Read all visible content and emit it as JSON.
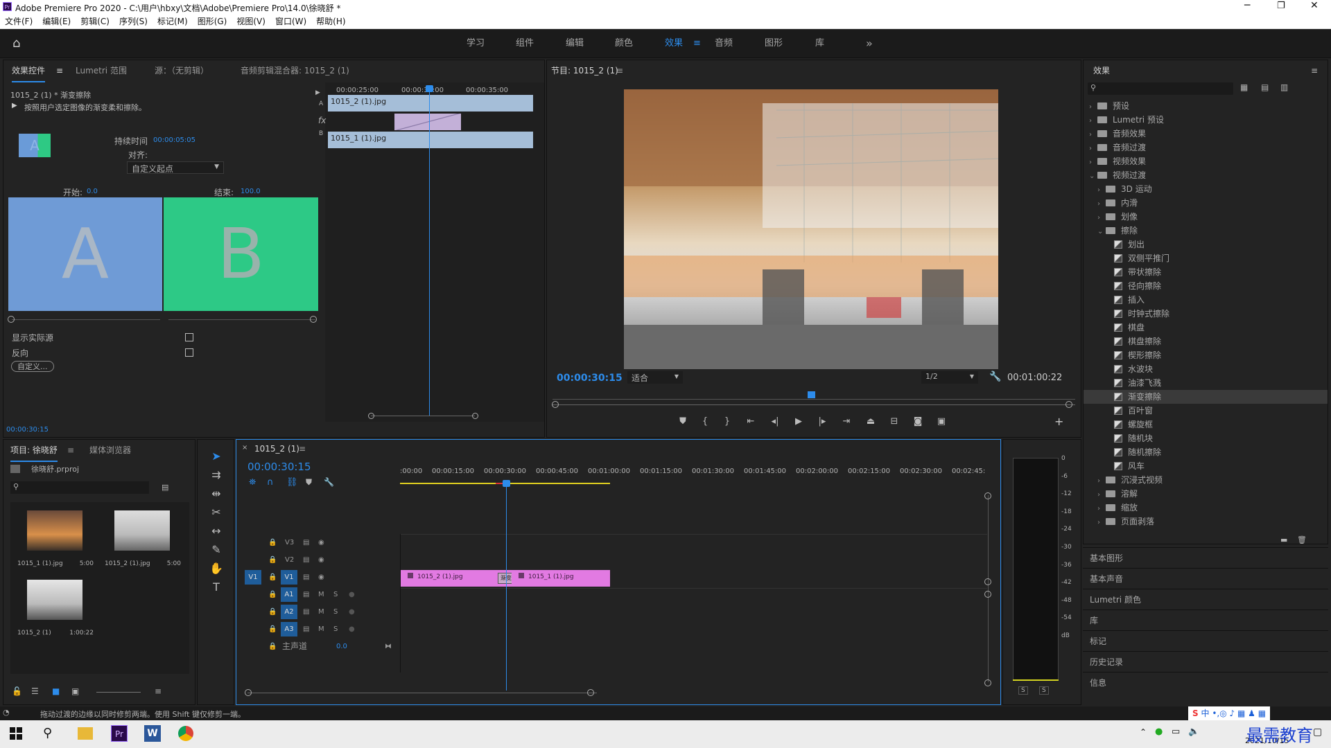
{
  "window": {
    "title": "Adobe Premiere Pro 2020 - C:\\用户\\hbxy\\文档\\Adobe\\Premiere Pro\\14.0\\徐晓舒 *"
  },
  "menu": [
    "文件(F)",
    "编辑(E)",
    "剪辑(C)",
    "序列(S)",
    "标记(M)",
    "图形(G)",
    "视图(V)",
    "窗口(W)",
    "帮助(H)"
  ],
  "workspaces": [
    "学习",
    "组件",
    "编辑",
    "颜色",
    "效果",
    "音频",
    "图形",
    "库"
  ],
  "active_workspace": "效果",
  "effect_controls": {
    "tabs": [
      "效果控件",
      "Lumetri 范围",
      "源：（无剪辑）",
      "音频剪辑混合器: 1015_2 (1)"
    ],
    "clip_name": "1015_2 (1) * 渐变擦除",
    "description": "按照用户选定图像的渐变柔和擦除。",
    "duration_label": "持续时间",
    "duration_value": "00:00:05:05",
    "align_label": "对齐:",
    "align_value": "自定义起点",
    "start_label": "开始:",
    "start_value": "0.0",
    "end_label": "结束:",
    "end_value": "100.0",
    "thumb_a": "A",
    "thumb_b": "B",
    "show_actual": "显示实际源",
    "reverse": "反向",
    "custom_btn": "自定义...",
    "timecode": "00:00:30:15",
    "ruler": [
      "00:00:25:00",
      "00:00:30:00",
      "00:00:35:00"
    ],
    "clip_a": "1015_2 (1).jpg",
    "clip_b": "1015_1 (1).jpg",
    "fx_label": "fx",
    "track_a": "A",
    "track_b": "B"
  },
  "program": {
    "title": "节目: 1015_2 (1)",
    "timecode": "00:00:30:15",
    "fit": "适合",
    "resolution": "1/2",
    "duration": "00:01:00:22"
  },
  "effects_panel": {
    "title": "效果",
    "tree": [
      {
        "label": "预设",
        "level": 0,
        "type": "folder",
        "expanded": false
      },
      {
        "label": "Lumetri 预设",
        "level": 0,
        "type": "folder",
        "expanded": false
      },
      {
        "label": "音频效果",
        "level": 0,
        "type": "folder",
        "expanded": false
      },
      {
        "label": "音频过渡",
        "level": 0,
        "type": "folder",
        "expanded": false
      },
      {
        "label": "视频效果",
        "level": 0,
        "type": "folder",
        "expanded": false
      },
      {
        "label": "视频过渡",
        "level": 0,
        "type": "folder",
        "expanded": true
      },
      {
        "label": "3D 运动",
        "level": 1,
        "type": "folder",
        "expanded": false
      },
      {
        "label": "内滑",
        "level": 1,
        "type": "folder",
        "expanded": false
      },
      {
        "label": "划像",
        "level": 1,
        "type": "folder",
        "expanded": false
      },
      {
        "label": "擦除",
        "level": 1,
        "type": "folder",
        "expanded": true
      },
      {
        "label": "划出",
        "level": 2,
        "type": "fx"
      },
      {
        "label": "双侧平推门",
        "level": 2,
        "type": "fx"
      },
      {
        "label": "带状擦除",
        "level": 2,
        "type": "fx"
      },
      {
        "label": "径向擦除",
        "level": 2,
        "type": "fx"
      },
      {
        "label": "插入",
        "level": 2,
        "type": "fx"
      },
      {
        "label": "时钟式擦除",
        "level": 2,
        "type": "fx"
      },
      {
        "label": "棋盘",
        "level": 2,
        "type": "fx"
      },
      {
        "label": "棋盘擦除",
        "level": 2,
        "type": "fx"
      },
      {
        "label": "楔形擦除",
        "level": 2,
        "type": "fx"
      },
      {
        "label": "水波块",
        "level": 2,
        "type": "fx"
      },
      {
        "label": "油漆飞溅",
        "level": 2,
        "type": "fx"
      },
      {
        "label": "渐变擦除",
        "level": 2,
        "type": "fx",
        "selected": true
      },
      {
        "label": "百叶窗",
        "level": 2,
        "type": "fx"
      },
      {
        "label": "螺旋框",
        "level": 2,
        "type": "fx"
      },
      {
        "label": "随机块",
        "level": 2,
        "type": "fx"
      },
      {
        "label": "随机擦除",
        "level": 2,
        "type": "fx"
      },
      {
        "label": "风车",
        "level": 2,
        "type": "fx"
      },
      {
        "label": "沉浸式视频",
        "level": 1,
        "type": "folder",
        "expanded": false
      },
      {
        "label": "溶解",
        "level": 1,
        "type": "folder",
        "expanded": false
      },
      {
        "label": "缩放",
        "level": 1,
        "type": "folder",
        "expanded": false
      },
      {
        "label": "页面剥落",
        "level": 1,
        "type": "folder",
        "expanded": false
      }
    ],
    "side_panels": [
      "基本图形",
      "基本声音",
      "Lumetri 颜色",
      "库",
      "标记",
      "历史记录",
      "信息"
    ]
  },
  "project": {
    "tabs": [
      "项目: 徐晓舒",
      "媒体浏览器"
    ],
    "file": "徐晓舒.prproj",
    "items": [
      {
        "name": "1015_1 (1).jpg",
        "duration": "5:00"
      },
      {
        "name": "1015_2 (1).jpg",
        "duration": "5:00"
      },
      {
        "name": "1015_2 (1)",
        "duration": "1:00:22"
      }
    ]
  },
  "timeline": {
    "tab": "1015_2 (1)",
    "timecode": "00:00:30:15",
    "ruler": [
      ":00:00",
      "00:00:15:00",
      "00:00:30:00",
      "00:00:45:00",
      "00:01:00:00",
      "00:01:15:00",
      "00:01:30:00",
      "00:01:45:00",
      "00:02:00:00",
      "00:02:15:00",
      "00:02:30:00",
      "00:02:45:"
    ],
    "video_tracks": [
      "V3",
      "V2",
      "V1"
    ],
    "audio_tracks": [
      "A1",
      "A2",
      "A3"
    ],
    "src_patch": "V1",
    "master_label": "主声道",
    "master_value": "0.0",
    "clip1": "1015_2 (1).jpg",
    "clip2": "1015_1 (1).jpg",
    "transition": "渐变",
    "m": "M",
    "s": "S"
  },
  "meter": {
    "ticks": [
      "0",
      "-6",
      "-12",
      "-18",
      "-24",
      "-30",
      "-36",
      "-42",
      "-48",
      "-54",
      "dB"
    ],
    "s": "S"
  },
  "status": {
    "text": "拖动过渡的边缘以同时修剪两端。使用 Shift 键仅修剪一端。"
  },
  "taskbar": {
    "date": "2021/10/15",
    "watermark": "最需教育",
    "ime": "中"
  },
  "colors": {
    "accent": "#2d8ceb",
    "clip_pink": "#e27ae2",
    "clip_blue": "#a5bed8",
    "bg": "#232323"
  }
}
